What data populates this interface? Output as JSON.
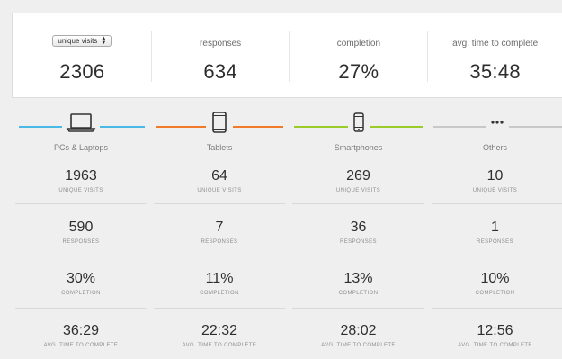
{
  "summary": {
    "select": {
      "selected": "unique visits"
    },
    "metrics": [
      {
        "label": "",
        "value": "2306"
      },
      {
        "label": "responses",
        "value": "634"
      },
      {
        "label": "completion",
        "value": "27%"
      },
      {
        "label": "avg. time to complete",
        "value": "35:48"
      }
    ]
  },
  "devices": [
    {
      "name": "PCs & Laptops",
      "icon": "laptop-icon",
      "color": "#4ab9e6",
      "visits": "1963",
      "visits_label": "UNIQUE VISITS",
      "responses": "590",
      "responses_label": "RESPONSES",
      "completion": "30%",
      "completion_label": "COMPLETION",
      "time": "36:29",
      "time_label": "AVG. TIME TO COMPLETE"
    },
    {
      "name": "Tablets",
      "icon": "tablet-icon",
      "color": "#f07a2a",
      "visits": "64",
      "visits_label": "UNIQUE VISITS",
      "responses": "7",
      "responses_label": "RESPONSES",
      "completion": "11%",
      "completion_label": "COMPLETION",
      "time": "22:32",
      "time_label": "AVG. TIME TO COMPLETE"
    },
    {
      "name": "Smartphones",
      "icon": "smartphone-icon",
      "color": "#9ccc2c",
      "visits": "269",
      "visits_label": "UNIQUE VISITS",
      "responses": "36",
      "responses_label": "RESPONSES",
      "completion": "13%",
      "completion_label": "COMPLETION",
      "time": "28:02",
      "time_label": "AVG. TIME TO COMPLETE"
    },
    {
      "name": "Others",
      "icon": "more-dots-icon",
      "color": "#c8c8c8",
      "visits": "10",
      "visits_label": "UNIQUE VISITS",
      "responses": "1",
      "responses_label": "RESPONSES",
      "completion": "10%",
      "completion_label": "COMPLETION",
      "time": "12:56",
      "time_label": "AVG. TIME TO COMPLETE"
    }
  ]
}
